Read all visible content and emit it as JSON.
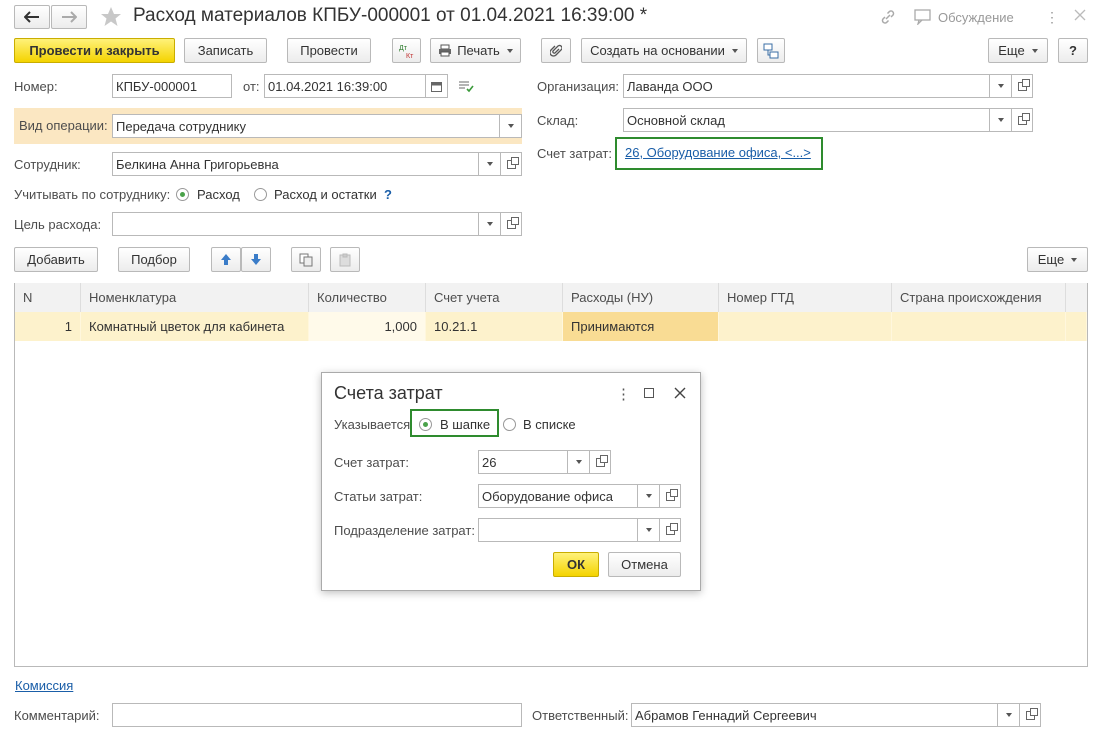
{
  "window": {
    "title": "Расход материалов КПБУ-000001 от 01.04.2021 16:39:00 *",
    "discussion_label": "Обсуждение"
  },
  "toolbar": {
    "post_close": "Провести и закрыть",
    "save": "Записать",
    "post": "Провести",
    "dtkt": "Дт Кт",
    "print": "Печать",
    "create_based": "Создать на основании",
    "more": "Еще",
    "help": "?"
  },
  "header": {
    "number_label": "Номер:",
    "number_value": "КПБУ-000001",
    "date_label": "от:",
    "date_value": "01.04.2021 16:39:00",
    "org_label": "Организация:",
    "org_value": "Лаванда ООО",
    "operation_label": "Вид операции:",
    "operation_value": "Передача сотруднику",
    "warehouse_label": "Склад:",
    "warehouse_value": "Основной склад",
    "cost_account_label": "Счет затрат:",
    "cost_account_link": "26, Оборудование офиса, <...>",
    "employee_label": "Сотрудник:",
    "employee_value": "Белкина Анна Григорьевна",
    "account_by_label": "Учитывать по сотруднику:",
    "radio_expense": "Расход",
    "radio_expense_balance": "Расход и остатки",
    "hint": "?",
    "purpose_label": "Цель расхода:",
    "purpose_value": ""
  },
  "table_toolbar": {
    "add": "Добавить",
    "pick": "Подбор",
    "more": "Еще"
  },
  "table": {
    "columns": [
      "N",
      "Номенклатура",
      "Количество",
      "Счет учета",
      "Расходы (НУ)",
      "Номер ГТД",
      "Страна происхождения"
    ],
    "rows": [
      [
        "1",
        "Комнатный цветок для кабинета",
        "1,000",
        "10.21.1",
        "Принимаются",
        "",
        ""
      ]
    ]
  },
  "dialog": {
    "title": "Счета затрат",
    "specified_label": "Указывается",
    "radio_header": "В шапке",
    "radio_list": "В списке",
    "account_label": "Счет затрат:",
    "account_value": "26",
    "items_label": "Статьи затрат:",
    "items_value": "Оборудование офиса",
    "dept_label": "Подразделение затрат:",
    "dept_value": "",
    "ok": "ОК",
    "cancel": "Отмена"
  },
  "footer": {
    "commission_link": "Комиссия",
    "comment_label": "Комментарий:",
    "comment_value": "",
    "responsible_label": "Ответственный:",
    "responsible_value": "Абрамов Геннадий Сергеевич"
  },
  "colors": {
    "accent_yellow": "#f4d300",
    "highlight_green": "#2e8b2e",
    "link_blue": "#1a5ea8",
    "row_yellow": "#fdf2cc",
    "operation_bg": "#fbe7c2"
  }
}
